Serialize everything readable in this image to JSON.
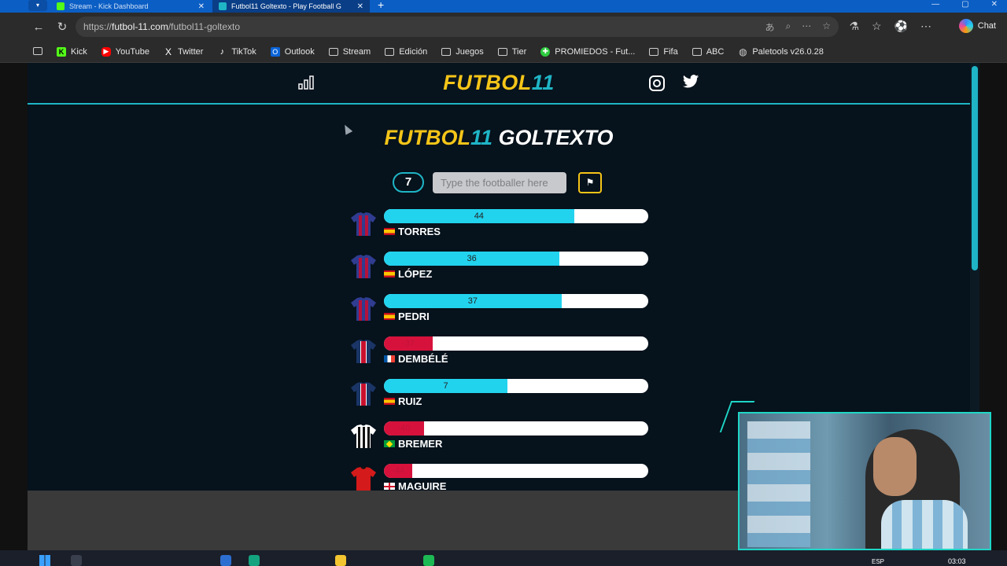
{
  "browser": {
    "tabs": [
      {
        "title": "Stream - Kick Dashboard",
        "active": false,
        "icon_color": "#53fc18"
      },
      {
        "title": "Futbol11 Goltexto - Play Football G",
        "active": true,
        "icon_color": "#1fb5c6"
      }
    ],
    "url": {
      "prefix": "https://",
      "host": "futbol-11.com",
      "path": "/futbol11-goltexto"
    },
    "chat_label": "Chat",
    "bookmarks": [
      {
        "label": "Kick",
        "icon": "kick-icon",
        "color": "#53fc18"
      },
      {
        "label": "YouTube",
        "icon": "youtube-icon",
        "color": "#ff0000"
      },
      {
        "label": "Twitter",
        "icon": "x-icon",
        "color": "#ffffff"
      },
      {
        "label": "TikTok",
        "icon": "tiktok-icon",
        "color": "#ffffff"
      },
      {
        "label": "Outlook",
        "icon": "outlook-icon",
        "color": "#0a64d8"
      },
      {
        "label": "Stream",
        "icon": "folder-icon"
      },
      {
        "label": "Edición",
        "icon": "folder-icon"
      },
      {
        "label": "Juegos",
        "icon": "folder-icon"
      },
      {
        "label": "Tier",
        "icon": "folder-icon"
      },
      {
        "label": "PROMIEDOS - Fut...",
        "icon": "promiedos-icon",
        "color": "#2ecc40"
      },
      {
        "label": "Fifa",
        "icon": "folder-icon"
      },
      {
        "label": "ABC",
        "icon": "folder-icon"
      },
      {
        "label": "Paletools v26.0.28",
        "icon": "globe-icon"
      }
    ]
  },
  "site": {
    "logo": {
      "part1": "FUTBOL",
      "part2": "11"
    },
    "title": {
      "part1": "FUTBOL",
      "part2": "11",
      "part3": "GOLTEXTO"
    },
    "attempts": "7",
    "input_placeholder": "Type the footballer here",
    "colors": {
      "accent": "#1fb5c6",
      "yellow": "#f5c518",
      "negative": "#d6123c",
      "positive": "#22d3ee"
    },
    "guesses": [
      {
        "name": "TORRES",
        "value": "44",
        "score": 44,
        "flag": "es",
        "jersey": "barca"
      },
      {
        "name": "LÓPEZ",
        "value": "36",
        "score": 36,
        "flag": "es",
        "jersey": "barca"
      },
      {
        "name": "PEDRI",
        "value": "37",
        "score": 37,
        "flag": "es",
        "jersey": "barca"
      },
      {
        "name": "DEMBÉLÉ",
        "value": "-37",
        "score": -37,
        "flag": "fr",
        "jersey": "psg"
      },
      {
        "name": "RUIZ",
        "value": "7",
        "score": 7,
        "flag": "es",
        "jersey": "psg"
      },
      {
        "name": "BREMER",
        "value": "-40",
        "score": -40,
        "flag": "br",
        "jersey": "juventus"
      },
      {
        "name": "MAGUIRE",
        "value": "-44",
        "score": -44,
        "flag": "en",
        "jersey": "united"
      }
    ]
  },
  "taskbar": {
    "language": "ESP",
    "time": "03:03"
  }
}
